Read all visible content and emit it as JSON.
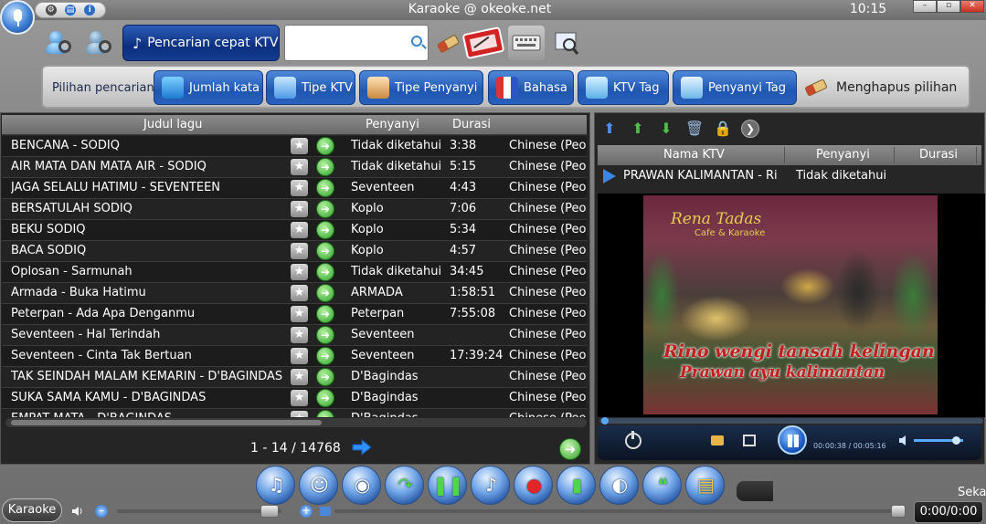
{
  "window": {
    "title": "Karaoke @ okeoke.net",
    "clock": "10:15",
    "mini_tools": [
      "gear-icon",
      "save-icon",
      "info-icon"
    ]
  },
  "search": {
    "quick_search_label": "Pencarian cepat KTV",
    "input_value": "",
    "input_placeholder": ""
  },
  "filters": {
    "label": "Pilihan pencarian",
    "buttons": [
      {
        "label": "Jumlah kata",
        "icon": "numbers-icon"
      },
      {
        "label": "Tipe KTV",
        "icon": "music-note-icon"
      },
      {
        "label": "Tipe Penyanyi",
        "icon": "people-icon"
      },
      {
        "label": "Bahasa",
        "icon": "flags-icon"
      },
      {
        "label": "KTV Tag",
        "icon": "tag-icon"
      },
      {
        "label": "Penyanyi Tag",
        "icon": "singer-tag-icon"
      }
    ],
    "clear_label": "Menghapus pilihan"
  },
  "song_list": {
    "columns": {
      "title": "Judul lagu",
      "singer": "Penyanyi",
      "duration": "Durasi"
    },
    "rows": [
      {
        "title": "BENCANA - SODIQ",
        "singer": "Tidak diketahui",
        "duration": "3:38",
        "language": "Chinese (Peop"
      },
      {
        "title": "AIR MATA DAN MATA AIR - SODIQ",
        "singer": "Tidak diketahui",
        "duration": "5:15",
        "language": "Chinese (Peop"
      },
      {
        "title": "JAGA SELALU HATIMU - SEVENTEEN",
        "singer": "Seventeen",
        "duration": "4:43",
        "language": "Chinese (Peop"
      },
      {
        "title": "BERSATULAH    SODIQ",
        "singer": "Koplo",
        "duration": "7:06",
        "language": "Chinese (Peop"
      },
      {
        "title": "BEKU    SODIQ",
        "singer": "Koplo",
        "duration": "5:34",
        "language": "Chinese (Peop"
      },
      {
        "title": "BACA    SODIQ",
        "singer": "Koplo",
        "duration": "4:57",
        "language": "Chinese (Peop"
      },
      {
        "title": "Oplosan - Sarmunah",
        "singer": "Tidak diketahui",
        "duration": "34:45",
        "language": "Chinese (Peop"
      },
      {
        "title": "Armada - Buka Hatimu",
        "singer": "ARMADA",
        "duration": "1:58:51",
        "language": "Chinese (Peop"
      },
      {
        "title": "Peterpan - Ada Apa Denganmu",
        "singer": "Peterpan",
        "duration": "7:55:08",
        "language": "Chinese (Peop"
      },
      {
        "title": "Seventeen - Hal Terindah",
        "singer": "Seventeen",
        "duration": "",
        "language": "Chinese (Peop"
      },
      {
        "title": "Seventeen - Cinta Tak Bertuan",
        "singer": "Seventeen",
        "duration": "17:39:24",
        "language": "Chinese (Peop"
      },
      {
        "title": "TAK SEINDAH MALAM KEMARIN - D'BAGINDAS",
        "singer": "D'Bagindas",
        "duration": "",
        "language": "Chinese (Peop"
      },
      {
        "title": "SUKA SAMA KAMU - D'BAGINDAS",
        "singer": "D'Bagindas",
        "duration": "",
        "language": "Chinese (Peop"
      },
      {
        "title": "EMPAT MATA - D'BAGINDAS",
        "singer": "D'Bagindas",
        "duration": "",
        "language": "Chinese (Peop"
      }
    ],
    "pager": "1   -  14 / 14768"
  },
  "playlist": {
    "columns": {
      "name": "Nama KTV",
      "singer": "Penyanyi",
      "duration": "Durasi"
    },
    "current": {
      "name": "PRAWAN KALIMANTAN - Ri",
      "singer": "Tidak diketahui",
      "duration": ""
    }
  },
  "video": {
    "venue_name": "Rena Tadas",
    "venue_sub": "Cafe & Karaoke",
    "lyric_line_1": "Rino wengi tansah kelingan",
    "lyric_line_2": "Prawan ayu kalimantan",
    "time": "00:00:38 / 00:05:16",
    "progress": 0.12,
    "volume": 0.85
  },
  "bottom": {
    "karaoke_label": "Karaoke",
    "seka_label": "Seka",
    "total_time": "0:00/0:00",
    "master_volume": 0.93
  },
  "colors": {
    "accent_blue": "#1f56b0",
    "play_green": "#2ea12a",
    "lyric_red": "#c01f1f"
  }
}
